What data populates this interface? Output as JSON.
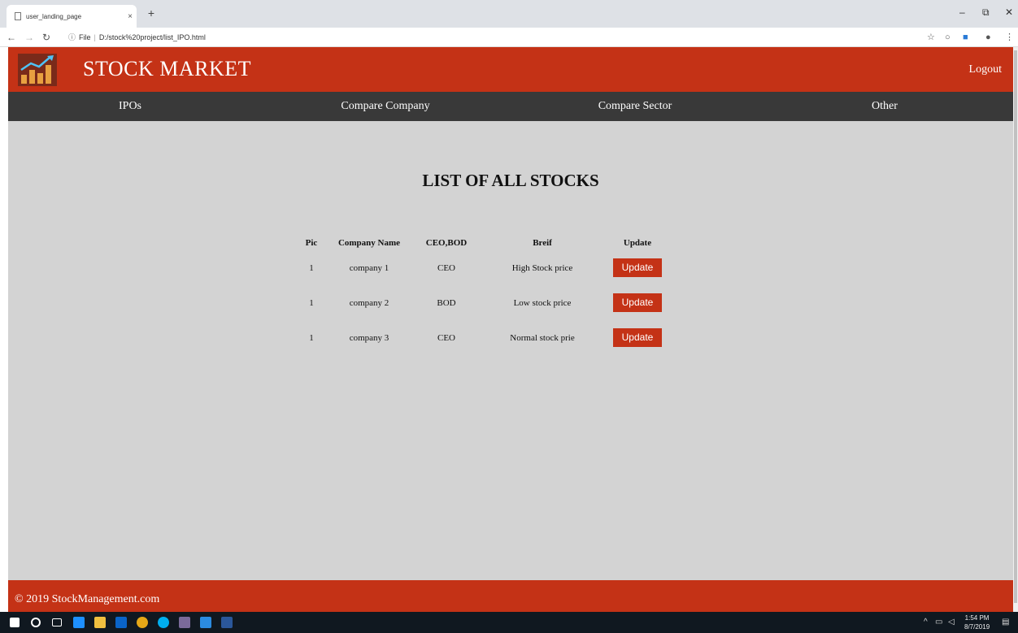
{
  "browser": {
    "tab_title": "user_landing_page",
    "tab_close": "×",
    "new_tab": "+",
    "url_scheme": "File",
    "url": "D:/stock%20project/list_IPO.html",
    "min": "–",
    "max": "⧉",
    "close": "✕"
  },
  "header": {
    "title": "STOCK MARKET",
    "logout": "Logout",
    "brand_color": "#c43216"
  },
  "nav": {
    "items": [
      "IPOs",
      "Compare Company",
      "Compare Sector",
      "Other"
    ]
  },
  "main": {
    "heading": "LIST OF ALL STOCKS",
    "columns": [
      "Pic",
      "Company Name",
      "CEO,BOD",
      "Breif",
      "Update"
    ],
    "rows": [
      {
        "pic": "1",
        "company": "company 1",
        "role": "CEO",
        "brief": "High Stock price",
        "action": "Update"
      },
      {
        "pic": "1",
        "company": "company 2",
        "role": "BOD",
        "brief": "Low stock price",
        "action": "Update"
      },
      {
        "pic": "1",
        "company": "company 3",
        "role": "CEO",
        "brief": "Normal stock prie",
        "action": "Update"
      }
    ]
  },
  "footer": {
    "text": "© 2019 StockManagement.com"
  },
  "taskbar": {
    "time": "1:54 PM",
    "date": "8/7/2019"
  }
}
